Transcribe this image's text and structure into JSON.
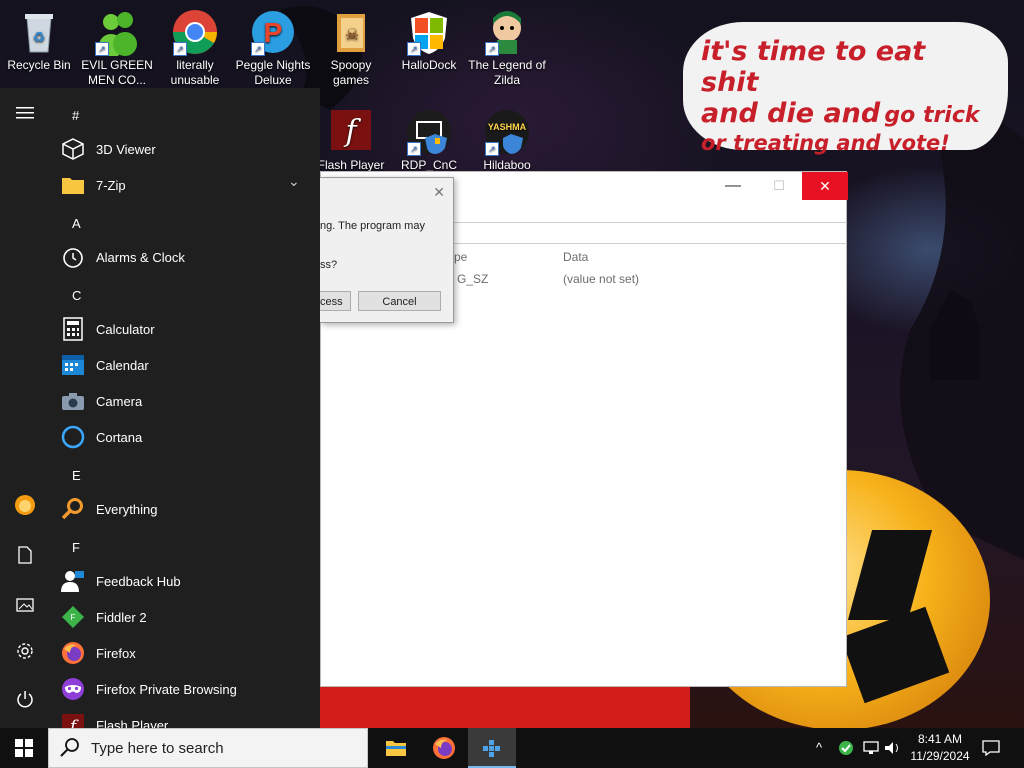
{
  "desktop": {
    "icons": [
      {
        "label": "Recycle Bin"
      },
      {
        "label": "EVIL GREEN MEN CO..."
      },
      {
        "label": "literally unusable"
      },
      {
        "label": "Peggle Nights Deluxe"
      },
      {
        "label": "Spoopy games"
      },
      {
        "label": "HalloDock"
      },
      {
        "label": "The Legend of Zilda"
      },
      {
        "label": "Flash Player"
      },
      {
        "label": "RDP_CnC"
      },
      {
        "label": "Hildaboo"
      }
    ],
    "bubble": {
      "line1": "it's time to eat shit",
      "line2a": "and die and",
      "line2b": "go trick",
      "line3": "or treating and vote!"
    },
    "rdp_logo_text": "YASHMA"
  },
  "regedit": {
    "col_type": "pe",
    "col_data": "Data",
    "row_type": "G_SZ",
    "row_data": "(value not set)",
    "min_glyph": "—",
    "max_glyph": "☐",
    "close_glyph": "✕"
  },
  "dialog": {
    "message": "ng. The program may",
    "message2": "ss?",
    "primary_button": "cess",
    "cancel_button": "Cancel",
    "close_glyph": "✕"
  },
  "start_menu": {
    "letters": [
      "#",
      "A",
      "C",
      "E",
      "F"
    ],
    "apps": [
      {
        "label": "3D Viewer"
      },
      {
        "label": "7-Zip"
      },
      {
        "label": "Alarms & Clock"
      },
      {
        "label": "Calculator"
      },
      {
        "label": "Calendar"
      },
      {
        "label": "Camera"
      },
      {
        "label": "Cortana"
      },
      {
        "label": "Everything"
      },
      {
        "label": "Feedback Hub"
      },
      {
        "label": "Fiddler 2"
      },
      {
        "label": "Firefox"
      },
      {
        "label": "Firefox Private Browsing"
      },
      {
        "label": "Flash Player"
      }
    ],
    "expand_glyph": "⌄",
    "fiddler_letter": "F"
  },
  "taskbar": {
    "search_placeholder": "Type here to search",
    "time": "8:41 AM",
    "date": "11/29/2024"
  },
  "colors": {
    "accent_red": "#e81123",
    "bubble_text": "#c8202a"
  }
}
